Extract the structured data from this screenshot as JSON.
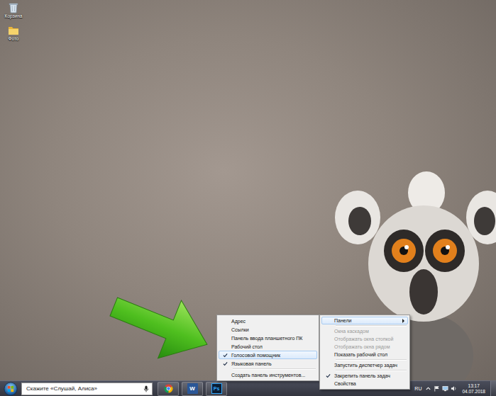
{
  "desktop": {
    "icons": [
      {
        "label": "Корзина",
        "kind": "recycle-bin"
      },
      {
        "label": "Фото",
        "kind": "folder"
      }
    ]
  },
  "context_menu": {
    "groups": [
      [
        {
          "label": "Панели",
          "submenu": true,
          "selected": true,
          "disabled": false,
          "checked": false
        }
      ],
      [
        {
          "label": "Окна каскадом",
          "submenu": false,
          "selected": false,
          "disabled": true,
          "checked": false
        },
        {
          "label": "Отображать окна стопкой",
          "submenu": false,
          "selected": false,
          "disabled": true,
          "checked": false
        },
        {
          "label": "Отображать окна рядом",
          "submenu": false,
          "selected": false,
          "disabled": true,
          "checked": false
        },
        {
          "label": "Показать рабочий стол",
          "submenu": false,
          "selected": false,
          "disabled": false,
          "checked": false
        }
      ],
      [
        {
          "label": "Запустить диспетчер задач",
          "submenu": false,
          "selected": false,
          "disabled": false,
          "checked": false
        }
      ],
      [
        {
          "label": "Закрепить панель задач",
          "submenu": false,
          "selected": false,
          "disabled": false,
          "checked": true
        },
        {
          "label": "Свойства",
          "submenu": false,
          "selected": false,
          "disabled": false,
          "checked": false
        }
      ]
    ]
  },
  "submenu": {
    "groups": [
      [
        {
          "label": "Адрес",
          "submenu": false,
          "selected": false,
          "disabled": false,
          "checked": false
        },
        {
          "label": "Ссылки",
          "submenu": false,
          "selected": false,
          "disabled": false,
          "checked": false
        },
        {
          "label": "Панель ввода планшетного ПК",
          "submenu": false,
          "selected": false,
          "disabled": false,
          "checked": false
        },
        {
          "label": "Рабочий стол",
          "submenu": false,
          "selected": false,
          "disabled": false,
          "checked": false
        },
        {
          "label": "Голосовой помощник",
          "submenu": false,
          "selected": true,
          "disabled": false,
          "checked": true
        },
        {
          "label": "Языковая панель",
          "submenu": false,
          "selected": false,
          "disabled": false,
          "checked": true
        }
      ],
      [
        {
          "label": "Создать панель инструментов...",
          "submenu": false,
          "selected": false,
          "disabled": false,
          "checked": false
        }
      ]
    ]
  },
  "taskbar": {
    "search": {
      "placeholder": "Скажите «Слушай, Алиса»"
    },
    "apps": [
      {
        "kind": "chrome"
      },
      {
        "kind": "word",
        "label": "W"
      },
      {
        "kind": "photoshop",
        "label": "Ps"
      }
    ],
    "tray": {
      "language": "RU",
      "time": "13:17",
      "date": "04.07.2018"
    }
  }
}
